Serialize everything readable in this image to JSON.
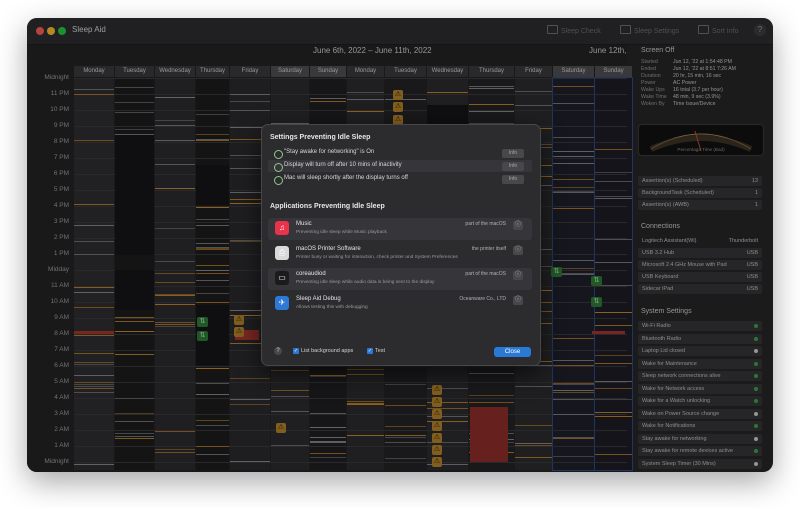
{
  "window": {
    "title": "Sleep Aid",
    "toolbar": [
      {
        "label": "Sleep Check",
        "icon": "checkbox-icon"
      },
      {
        "label": "Sleep Settings",
        "icon": "settings-icon"
      },
      {
        "label": "Sort Info",
        "icon": "list-icon"
      }
    ],
    "help": "?"
  },
  "chart": {
    "range_left": "June 6th, 2022 – June 11th, 2022",
    "range_right": "June 12th,",
    "days": [
      "Monday",
      "Tuesday",
      "Wednesday",
      "Thursday",
      "Friday",
      "Saturday",
      "Sunday",
      "Monday",
      "Tuesday",
      "Wednesday",
      "Thursday",
      "Friday",
      "Saturday",
      "Sunday"
    ],
    "y_labels": [
      "Midnight",
      "11 PM",
      "10 PM",
      "9 PM",
      "8 PM",
      "7 PM",
      "6 PM",
      "5 PM",
      "4 PM",
      "3 PM",
      "2 PM",
      "1 PM",
      "Midday",
      "11 AM",
      "10 AM",
      "9 AM",
      "8 AM",
      "7 AM",
      "6 AM",
      "5 AM",
      "4 AM",
      "3 AM",
      "2 AM",
      "1 AM",
      "Midnight"
    ]
  },
  "sidebar": {
    "screen_title": "Screen Off",
    "screen_info": [
      {
        "k": "Started",
        "v": "Jun 12, '22 at 1:54:48 PM"
      },
      {
        "k": "Ended",
        "v": "Jun 12, '22 at 8:51 7:26 AM"
      },
      {
        "k": "Duration",
        "v": "20 hr, 15 min, 16 sec"
      },
      {
        "k": "Power",
        "v": "AC Power"
      },
      {
        "k": "Wake Ups",
        "v": "16 total (3.7 per hour)"
      },
      {
        "k": "Wake Time",
        "v": "48 min, 9 sec (3.9%)"
      },
      {
        "k": "Woken By",
        "v": "Time Issue/Device"
      }
    ],
    "gauge_caption": "Percentage Time (Bad)",
    "assertions": [
      {
        "label": "Assertion(s) (Scheduled)",
        "value": "13"
      },
      {
        "label": "BackgroundTask (Scheduled)",
        "value": "1"
      },
      {
        "label": "Assertion(s) (AWB)",
        "value": "1"
      }
    ],
    "connections_title": "Connections",
    "connections_header": {
      "label": "Logitech Assistant(Wi)",
      "value": "Thunderbolt"
    },
    "connections": [
      {
        "label": "USB 3.2 Hub",
        "value": "USB"
      },
      {
        "label": "Microsoft 2.4 GHz Mouse with Pad",
        "value": "USB"
      },
      {
        "label": "USB Keyboard",
        "value": "USB"
      },
      {
        "label": "Sidecar iPad",
        "value": "USB"
      }
    ],
    "settings_title": "System Settings",
    "settings": [
      {
        "label": "Wi-Fi Radio",
        "color": "#3aa64c"
      },
      {
        "label": "Bluetooth Radio",
        "color": "#3aa64c"
      },
      {
        "label": "Laptop Lid closed",
        "color": "#cfcfcf"
      },
      {
        "label": "Wake for Maintenance",
        "color": "#3aa64c"
      },
      {
        "label": "Sleep network connections alive",
        "color": "#3aa64c"
      },
      {
        "label": "Wake for Network access",
        "color": "#3aa64c"
      },
      {
        "label": "Wake for a Watch unlocking",
        "color": "#3aa64c"
      },
      {
        "label": "Wake on Power Source change",
        "color": "#cfcfcf"
      },
      {
        "label": "Wake for Notifications",
        "color": "#3aa64c"
      },
      {
        "label": "Stay awake for networking",
        "color": "#cfcfcf"
      },
      {
        "label": "Stay awake for remote devices active",
        "color": "#3aa64c"
      },
      {
        "label": "System Sleep Timer (30 Mins)",
        "color": "#cfcfcf"
      }
    ]
  },
  "modal": {
    "settings_title": "Settings Preventing Idle Sleep",
    "settings": [
      {
        "text": "\"Stay awake for networking\" is On",
        "button": "Info"
      },
      {
        "text": "Display will turn off after 10 mins of inactivity",
        "button": "Info"
      },
      {
        "text": "Mac will sleep shortly after the display turns off",
        "button": "Info"
      }
    ],
    "apps_title": "Applications Preventing Idle Sleep",
    "apps": [
      {
        "name": "Music",
        "desc": "Preventing idle sleep while Music playback",
        "right": "part of the macOS",
        "icon": "music-icon",
        "color": "#e8334a"
      },
      {
        "name": "macOS Printer Software",
        "desc": "Printer busy or waiting for interaction, check printer and System Preferences",
        "right": "the printer itself",
        "icon": "printer-icon",
        "color": "#d9d9d9"
      },
      {
        "name": "coreaudiod",
        "desc": "Preventing idle sleep while audio data is being sent to the display",
        "right": "part of the macOS",
        "icon": "terminal-icon",
        "color": "#1b1b1b"
      },
      {
        "name": "Sleep Aid Debug",
        "desc": "Allows testing this with debugging",
        "right": "Oceanware Co., LTD",
        "icon": "sleep-aid-icon",
        "color": "#2d7ad6"
      }
    ],
    "show_background": "List background apps",
    "test": "Test",
    "close": "Close",
    "help": "?"
  }
}
